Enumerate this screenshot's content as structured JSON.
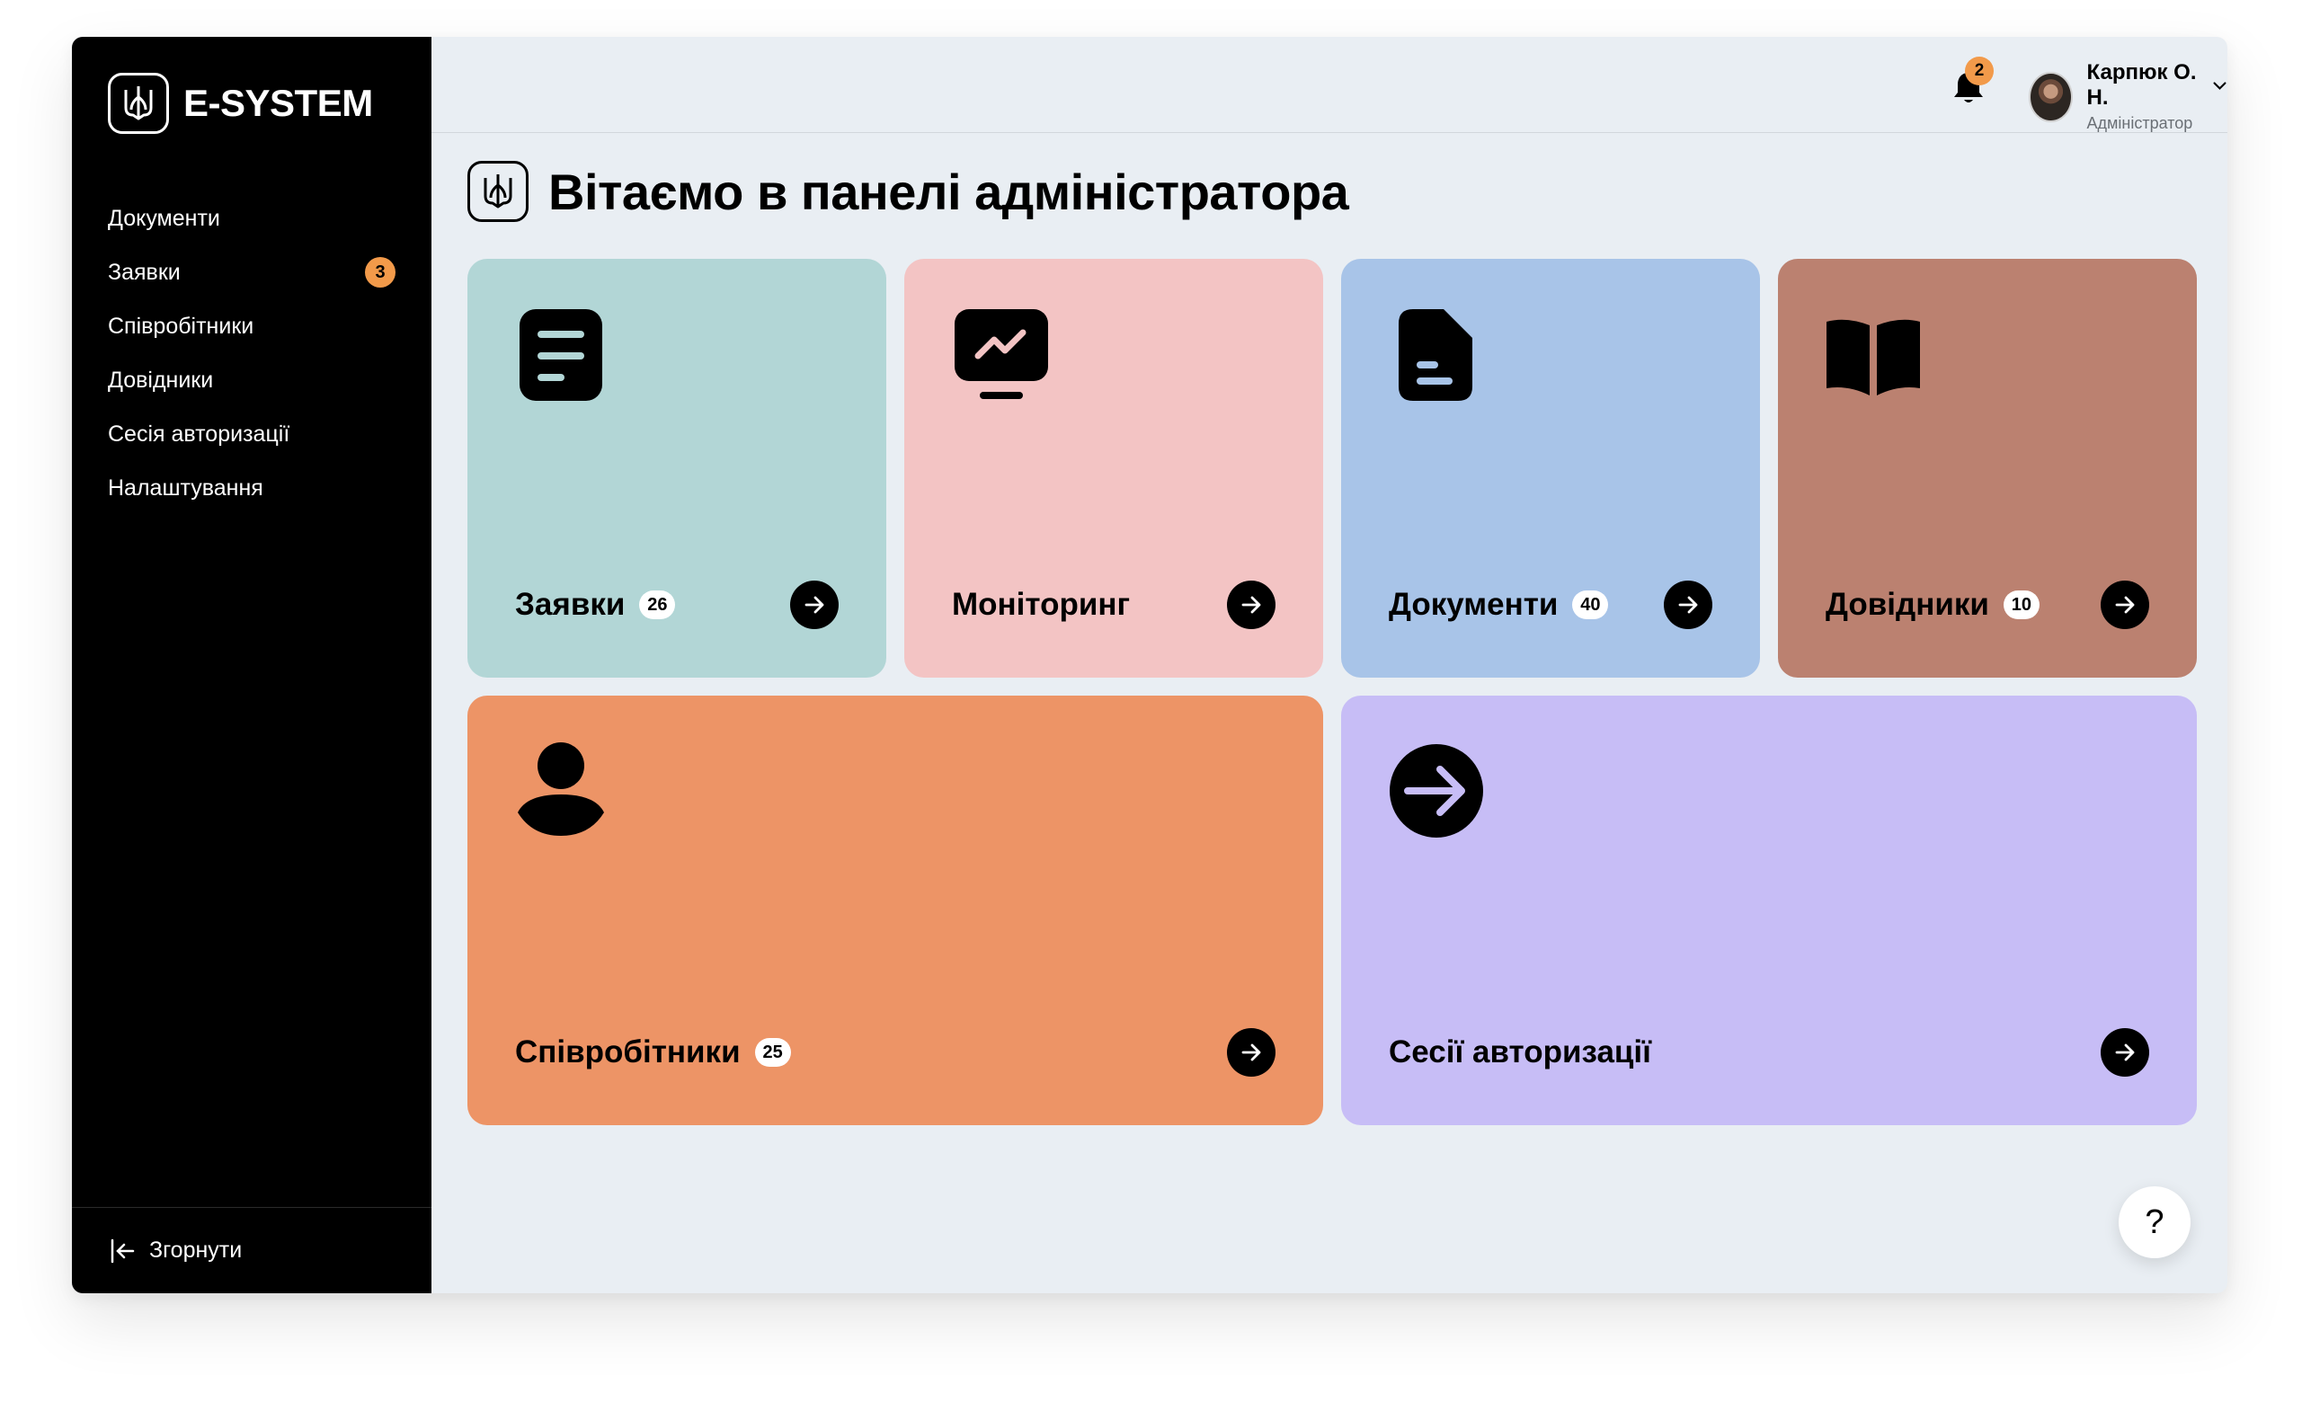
{
  "app": {
    "logo_text": "E-SYSTEM"
  },
  "sidebar": {
    "items": [
      {
        "label": "Документи"
      },
      {
        "label": "Заявки",
        "badge": "3"
      },
      {
        "label": "Співробітники"
      },
      {
        "label": "Довідники"
      },
      {
        "label": "Сесія авторизації"
      },
      {
        "label": "Налаштування"
      }
    ],
    "collapse_label": "Згорнути"
  },
  "header": {
    "notifications_count": "2",
    "user_name": "Карпюк О. Н.",
    "user_role": "Адміністратор"
  },
  "main": {
    "title": "Вітаємо в панелі адміністратора",
    "tiles": [
      {
        "label": "Заявки",
        "count": "26",
        "color": "#b2d6d6",
        "icon": "document-lines-icon"
      },
      {
        "label": "Моніторинг",
        "color": "#f3c4c4",
        "icon": "monitor-chart-icon"
      },
      {
        "label": "Документи",
        "count": "40",
        "color": "#a8c4e8",
        "icon": "file-icon"
      },
      {
        "label": "Довідники",
        "count": "10",
        "color": "#bb8170",
        "icon": "book-icon"
      },
      {
        "label": "Співробітники",
        "count": "25",
        "color": "#ed9466",
        "icon": "user-icon"
      },
      {
        "label": "Сесії авторизації",
        "color": "#c7bdf6",
        "icon": "login-arrow-icon"
      }
    ]
  },
  "help_label": "?"
}
